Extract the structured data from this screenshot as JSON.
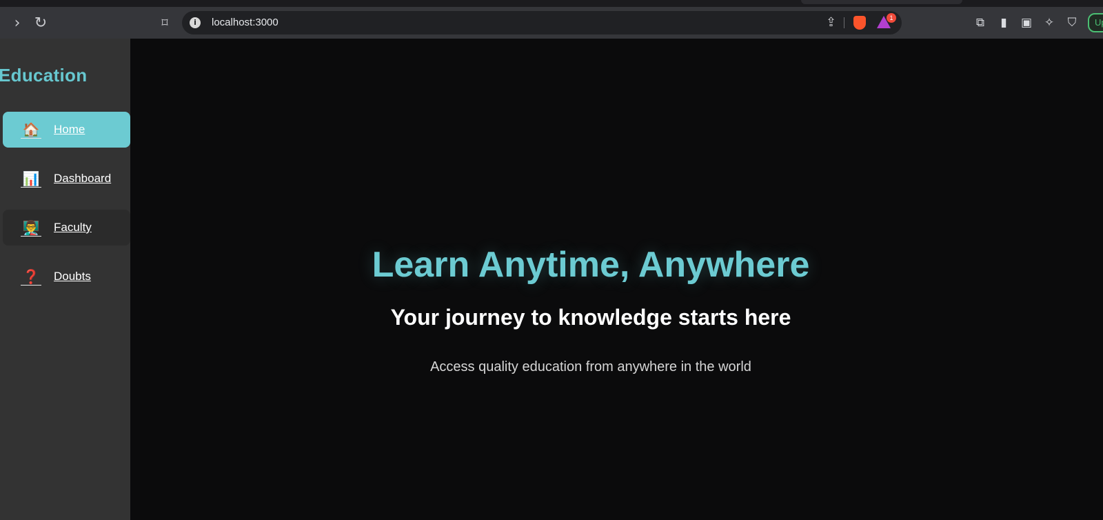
{
  "browser": {
    "url": "localhost:3000",
    "rewards_badge": "1",
    "update_label": "Up",
    "icons": {
      "forward": "chevron-right-icon",
      "reload": "reload-icon",
      "bookmark": "bookmark-icon",
      "site_info": "info-icon",
      "share": "share-icon",
      "brave_shields": "brave-lion-icon",
      "rewards": "brave-rewards-icon",
      "extensions": "puzzle-icon",
      "sidebar": "sidebar-icon",
      "wallet": "wallet-icon",
      "leo": "sparkle-icon",
      "vpn": "shield-icon"
    }
  },
  "sidebar": {
    "brand": "Education",
    "items": [
      {
        "label": "Home",
        "icon": "🏠",
        "state": "active"
      },
      {
        "label": "Dashboard",
        "icon": "📊",
        "state": "normal"
      },
      {
        "label": "Faculty",
        "icon": "👨‍🏫",
        "state": "hover"
      },
      {
        "label": "Doubts",
        "icon": "❓",
        "state": "normal"
      }
    ]
  },
  "hero": {
    "title": "Learn Anytime, Anywhere",
    "subtitle": "Your journey to knowledge starts here",
    "description": "Access quality education from anywhere in the world"
  },
  "colors": {
    "accent": "#6ccbd2",
    "sidebar_bg": "#333333",
    "page_bg": "#0b0b0c"
  }
}
